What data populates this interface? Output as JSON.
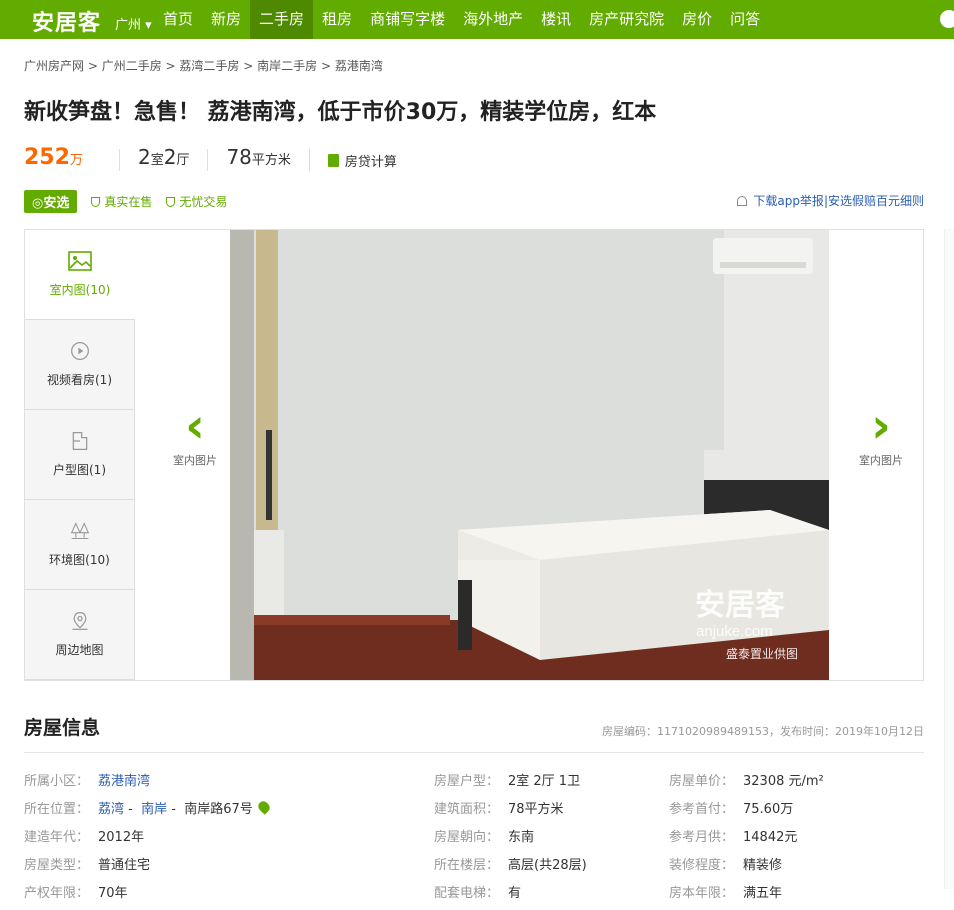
{
  "header": {
    "logo": "安居客",
    "city": "广州",
    "nav": [
      "首页",
      "新房",
      "二手房",
      "租房",
      "商铺写字楼",
      "海外地产",
      "楼讯",
      "房产研究院",
      "房价",
      "问答"
    ],
    "active_nav": "二手房"
  },
  "breadcrumb": [
    "广州房产网",
    "广州二手房",
    "荔湾二手房",
    "南岸二手房",
    "荔港南湾"
  ],
  "title": "新收笋盘！急售！ 荔港南湾，低于市价30万，精装学位房，红本",
  "summary": {
    "price": "252",
    "price_unit": "万",
    "rooms": "2",
    "rooms_unit": "室",
    "halls": "2",
    "halls_unit": "厅",
    "area": "78",
    "area_unit": "平方米",
    "calc": "房贷计算"
  },
  "badges": {
    "anxuan": "安选",
    "real": "真实在售",
    "worry_free": "无忧交易",
    "report": "下载app举报",
    "divider": " | ",
    "compensation": "安选假赔百元细则"
  },
  "gallery": {
    "tabs": [
      {
        "label": "室内图(10)",
        "icon": "image-icon"
      },
      {
        "label": "视频看房(1)",
        "icon": "video-icon"
      },
      {
        "label": "户型图(1)",
        "icon": "floorplan-icon"
      },
      {
        "label": "环境图(10)",
        "icon": "trees-icon"
      },
      {
        "label": "周边地图",
        "icon": "map-icon"
      }
    ],
    "prev_label": "室内图片",
    "next_label": "室内图片",
    "watermark_brand": "安居客",
    "watermark_domain": "anjuke.com",
    "watermark_provider": "盛泰置业供图"
  },
  "info": {
    "heading": "房屋信息",
    "code_label": "房屋编码：",
    "code": "1171020989489153",
    "publish_label": "，发布时间：",
    "publish_date": "2019年10月12日",
    "rows": [
      [
        {
          "label": "所属小区：",
          "value": "荔港南湾"
        },
        {
          "label": "房屋户型：",
          "value": "2室 2厅 1卫"
        },
        {
          "label": "房屋单价：",
          "value": "32308 元/m²"
        }
      ],
      [
        {
          "label": "所在位置：",
          "value": "荔湾 - 南岸 - 南岸路67号"
        },
        {
          "label": "建筑面积：",
          "value": "78平方米"
        },
        {
          "label": "参考首付：",
          "value": "75.60万"
        }
      ],
      [
        {
          "label": "建造年代：",
          "value": "2012年"
        },
        {
          "label": "房屋朝向：",
          "value": "东南"
        },
        {
          "label": "参考月供：",
          "value": "14842元"
        }
      ],
      [
        {
          "label": "房屋类型：",
          "value": "普通住宅"
        },
        {
          "label": "所在楼层：",
          "value": "高层(共28层)"
        },
        {
          "label": "装修程度：",
          "value": "精装修"
        }
      ],
      [
        {
          "label": "产权年限：",
          "value": "70年"
        },
        {
          "label": "配套电梯：",
          "value": "有"
        },
        {
          "label": "房本年限：",
          "value": "满五年"
        }
      ]
    ],
    "location_parts": [
      "荔湾",
      "南岸",
      "南岸路67号"
    ]
  },
  "colors": {
    "brand": "#62ab00",
    "price": "#ff6600",
    "link": "#2a5db0"
  }
}
